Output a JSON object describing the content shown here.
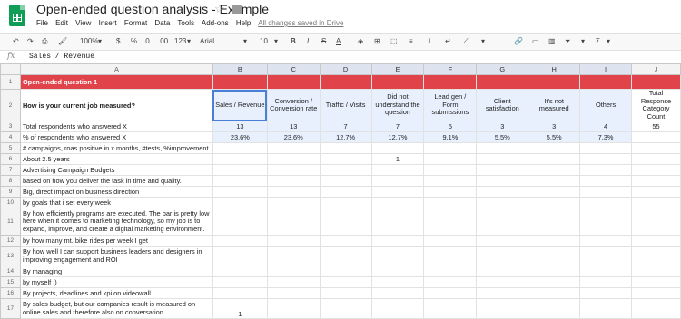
{
  "app": {
    "doc_title": "Open-ended question analysis - Example",
    "menu": [
      "File",
      "Edit",
      "View",
      "Insert",
      "Format",
      "Data",
      "Tools",
      "Add-ons",
      "Help"
    ],
    "saved_status": "All changes saved in Drive"
  },
  "toolbar": {
    "zoom": "100%",
    "currency": "$",
    "percent": "%",
    "decimal_less": ".0",
    "decimal_more": ".00",
    "number_format": "123",
    "font": "Arial",
    "font_size": "10",
    "bold": "B",
    "italic": "I",
    "strike": "S",
    "text_color": "A"
  },
  "formula_bar": {
    "fx": "fx",
    "content": "Sales / Revenue"
  },
  "columns": [
    "A",
    "B",
    "C",
    "D",
    "E",
    "F",
    "G",
    "H",
    "I",
    "J"
  ],
  "rows": [
    {
      "n": "1",
      "a": "Open-ended question 1",
      "cells": [
        "",
        "",
        "",
        "",
        "",
        "",
        "",
        "",
        ""
      ]
    },
    {
      "n": "2",
      "a": "How is your current job measured?",
      "cells": [
        "Sales / Revenue",
        "Conversion / Conversion rate",
        "Traffic / Visits",
        "Did not understand the question",
        "Lead gen / Form submissions",
        "Client satisfaction",
        "It's not measured",
        "Others",
        "Total Response Category Count"
      ]
    },
    {
      "n": "3",
      "a": "Total respondents who answered X",
      "cells": [
        "13",
        "13",
        "7",
        "7",
        "5",
        "3",
        "3",
        "4",
        "55"
      ]
    },
    {
      "n": "4",
      "a": "% of respondents who answered X",
      "cells": [
        "23.6%",
        "23.6%",
        "12.7%",
        "12.7%",
        "9.1%",
        "5.5%",
        "5.5%",
        "7.3%",
        ""
      ]
    },
    {
      "n": "5",
      "a": "# campaigns, roas positive in x months, #tests, %improvement",
      "cells": [
        "",
        "",
        "",
        "",
        "",
        "",
        "",
        "",
        ""
      ]
    },
    {
      "n": "6",
      "a": "About 2.5 years",
      "cells": [
        "",
        "",
        "",
        "1",
        "",
        "",
        "",
        "",
        ""
      ]
    },
    {
      "n": "7",
      "a": "Advertising Campaign Budgets",
      "cells": [
        "",
        "",
        "",
        "",
        "",
        "",
        "",
        "",
        ""
      ]
    },
    {
      "n": "8",
      "a": "based on how you deliver the task in time and quality.",
      "cells": [
        "",
        "",
        "",
        "",
        "",
        "",
        "",
        "",
        ""
      ]
    },
    {
      "n": "9",
      "a": "Big, direct impact on business direction",
      "cells": [
        "",
        "",
        "",
        "",
        "",
        "",
        "",
        "",
        ""
      ]
    },
    {
      "n": "10",
      "a": "by goals that i set every week",
      "cells": [
        "",
        "",
        "",
        "",
        "",
        "",
        "",
        "",
        ""
      ]
    },
    {
      "n": "11",
      "a": "By how efficiently programs are executed. The bar is pretty low here when it comes to marketing technology, so my job is to expand, improve, and create a digital marketing environment.",
      "cells": [
        "",
        "",
        "",
        "",
        "",
        "",
        "",
        "",
        ""
      ]
    },
    {
      "n": "12",
      "a": "by how many mt. bike rides per week I get",
      "cells": [
        "",
        "",
        "",
        "",
        "",
        "",
        "",
        "",
        ""
      ]
    },
    {
      "n": "13",
      "a": "By how well I can support business leaders and designers in improving engagement and ROI",
      "cells": [
        "",
        "",
        "",
        "",
        "",
        "",
        "",
        "",
        ""
      ]
    },
    {
      "n": "14",
      "a": "By managing",
      "cells": [
        "",
        "",
        "",
        "",
        "",
        "",
        "",
        "",
        ""
      ]
    },
    {
      "n": "15",
      "a": "by myself :)",
      "cells": [
        "",
        "",
        "",
        "",
        "",
        "",
        "",
        "",
        ""
      ]
    },
    {
      "n": "16",
      "a": "By projects, deadlines and kpi on videowall",
      "cells": [
        "",
        "",
        "",
        "",
        "",
        "",
        "",
        "",
        ""
      ]
    },
    {
      "n": "17",
      "a": "By sales budget, but our companies result is measured on online sales and therefore also on conversation.",
      "cells": [
        "1",
        "",
        "",
        "",
        "",
        "",
        "",
        "",
        ""
      ]
    }
  ]
}
